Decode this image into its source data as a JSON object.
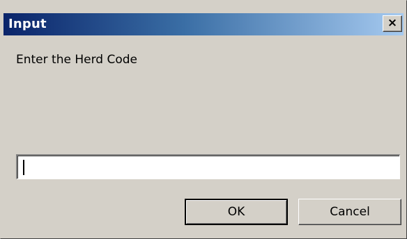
{
  "window": {
    "title": "Input",
    "close_symbol": "×",
    "close_icon": "close-icon"
  },
  "dialog": {
    "prompt": "Enter the Herd Code"
  },
  "input": {
    "value": "",
    "placeholder": ""
  },
  "buttons": {
    "ok_label": "OK",
    "cancel_label": "Cancel"
  },
  "colors": {
    "face": "#d4d0c8",
    "title_start": "#0a246a",
    "title_end": "#a6caf0"
  }
}
